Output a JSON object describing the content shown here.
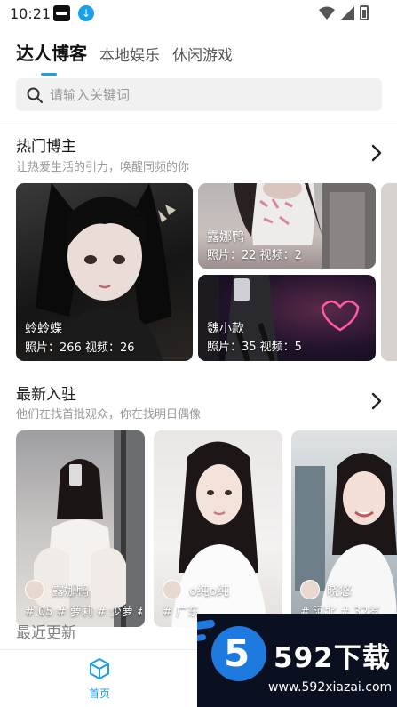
{
  "status_bar": {
    "time": "10:21"
  },
  "tabs": [
    {
      "label": "达人博客",
      "active": true
    },
    {
      "label": "本地娱乐",
      "active": false
    },
    {
      "label": "休闲游戏",
      "active": false
    }
  ],
  "search": {
    "placeholder": "请输入关键词"
  },
  "hot_bloggers": {
    "title": "热门博主",
    "subtitle": "让热爱生活的引力，唤醒同频的你",
    "cards": [
      {
        "name": "蛉蛉蝶",
        "stats": "照片：266 视频：26"
      },
      {
        "name": "露娜鸭",
        "stats": "照片：22  视频：2"
      },
      {
        "name": "魏小款",
        "stats": "照片：35  视频：5"
      }
    ]
  },
  "new_arrivals": {
    "title": "最新入驻",
    "subtitle": "他们在找首批观众，你在找明日偶像",
    "cards": [
      {
        "name": "露娜鸭",
        "tags": "# 05 # 萝莉 # 少萝 #"
      },
      {
        "name": "o纯o纯",
        "tags": "# 广东"
      },
      {
        "name": "晓悠",
        "tags": "# 河北 # 32岁"
      }
    ]
  },
  "third_section_title": "最近更新",
  "bottom_nav": {
    "home_label": "首页"
  },
  "watermark": {
    "brand": "592下载",
    "digit": "5",
    "url": "www.592xiazai.com"
  },
  "colors": {
    "accent": "#1aa0e8",
    "watermark_bg": "#0b1020",
    "watermark_blue": "#1f7ae0"
  }
}
